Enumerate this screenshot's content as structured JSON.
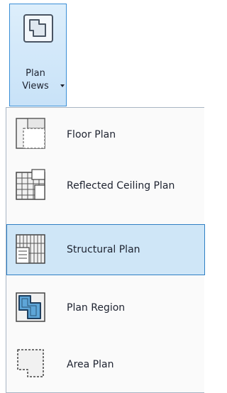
{
  "ribbon_button": {
    "label_line1": "Plan",
    "label_line2": "Views",
    "icon": "plan-views-icon"
  },
  "menu": {
    "items": [
      {
        "label": "Floor Plan",
        "icon": "floor-plan-icon",
        "selected": false
      },
      {
        "label": "Reflected Ceiling Plan",
        "icon": "reflected-ceiling-plan-icon",
        "selected": false
      },
      {
        "label": "Structural Plan",
        "icon": "structural-plan-icon",
        "selected": true
      },
      {
        "label": "Plan Region",
        "icon": "plan-region-icon",
        "selected": false
      },
      {
        "label": "Area Plan",
        "icon": "area-plan-icon",
        "selected": false
      }
    ]
  },
  "colors": {
    "selection_fill": "#cfe6f7",
    "selection_border": "#2f7fc4",
    "region_fill": "#5ea6d8"
  }
}
